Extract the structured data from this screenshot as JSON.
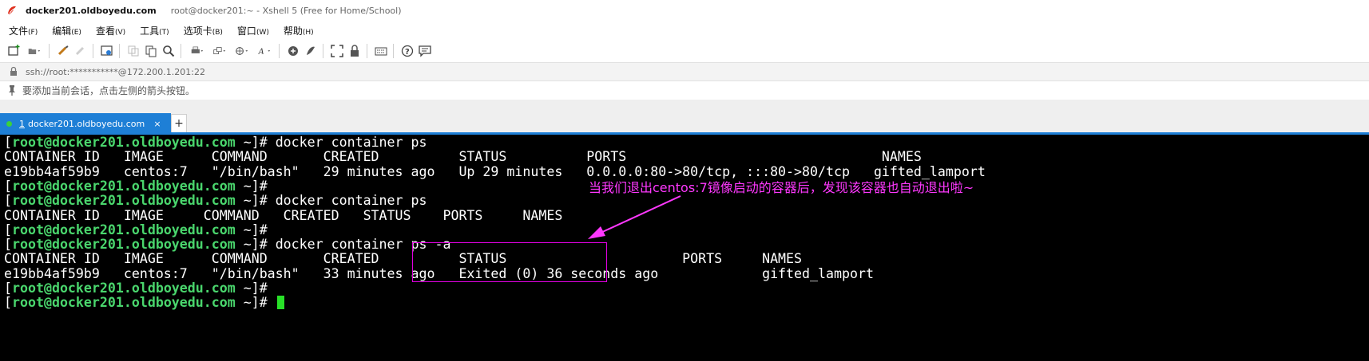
{
  "window": {
    "tab_title": "docker201.oldboyedu.com",
    "title": "root@docker201:~ - Xshell 5 (Free for Home/School)"
  },
  "menu": [
    {
      "label": "文件",
      "acc": "(F)"
    },
    {
      "label": "编辑",
      "acc": "(E)"
    },
    {
      "label": "查看",
      "acc": "(V)"
    },
    {
      "label": "工具",
      "acc": "(T)"
    },
    {
      "label": "选项卡",
      "acc": "(B)"
    },
    {
      "label": "窗口",
      "acc": "(W)"
    },
    {
      "label": "帮助",
      "acc": "(H)"
    }
  ],
  "address": "ssh://root:***********@172.200.1.201:22",
  "hint": "要添加当前会话，点击左侧的箭头按钮。",
  "session_tab": {
    "number": "1",
    "label": "docker201.oldboyedu.com",
    "close": "×",
    "add": "+"
  },
  "terminal": {
    "prompt_open": "[",
    "prompt_user": "root@docker201.oldboyedu.com",
    "prompt_close": " ~]# ",
    "lines": [
      {
        "type": "cmd",
        "text": "docker container ps"
      },
      {
        "type": "out",
        "text": "CONTAINER ID   IMAGE      COMMAND       CREATED          STATUS          PORTS                                NAMES"
      },
      {
        "type": "out",
        "text": "e19bb4af59b9   centos:7   \"/bin/bash\"   29 minutes ago   Up 29 minutes   0.0.0.0:80->80/tcp, :::80->80/tcp   gifted_lamport"
      },
      {
        "type": "cmd",
        "text": ""
      },
      {
        "type": "cmd",
        "text": "docker container ps"
      },
      {
        "type": "out",
        "text": "CONTAINER ID   IMAGE     COMMAND   CREATED   STATUS    PORTS     NAMES"
      },
      {
        "type": "cmd",
        "text": ""
      },
      {
        "type": "cmd",
        "text": "docker container ps -a"
      },
      {
        "type": "out",
        "text": "CONTAINER ID   IMAGE      COMMAND       CREATED          STATUS                      PORTS     NAMES"
      },
      {
        "type": "out",
        "text": "e19bb4af59b9   centos:7   \"/bin/bash\"   33 minutes ago   Exited (0) 36 seconds ago             gifted_lamport"
      },
      {
        "type": "cmd",
        "text": ""
      },
      {
        "type": "cmd",
        "text": "",
        "cursor": true
      }
    ],
    "annotation": "当我们退出centos:7镜像启动的容器后，发现该容器也自动退出啦~"
  },
  "colors": {
    "tab_active": "#1e7fd6",
    "prompt_host": "#4ad66d",
    "annotation": "#ff38ff",
    "cursor": "#28e028"
  }
}
